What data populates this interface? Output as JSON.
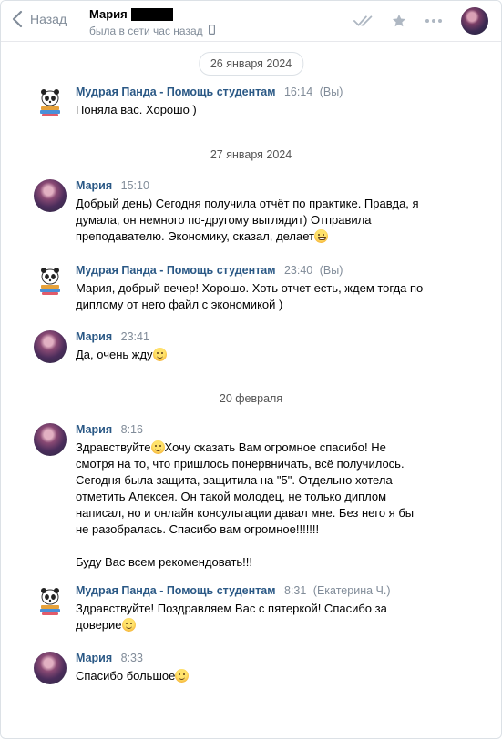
{
  "header": {
    "back_label": "Назад",
    "contact_name": "Мария",
    "status": "была в сети час назад",
    "icons": [
      "chevron-left-icon",
      "phone-icon",
      "double-check-icon",
      "star-icon",
      "more-icon"
    ]
  },
  "colors": {
    "author": "#2a5885",
    "muted": "#818c99",
    "border": "#dce1e6"
  },
  "dates": {
    "d1": "26 января 2024",
    "d2": "27 января 2024",
    "d3": "20 февраля"
  },
  "messages": [
    {
      "author": "Мудрая Панда - Помощь студентам",
      "time": "16:14",
      "note": "(Вы)",
      "text": "Поняла вас. Хорошо )"
    },
    {
      "author": "Мария",
      "time": "15:10",
      "line1": "Добрый день) Сегодня получила отчёт по практике. Правда, я",
      "line2": "думала, он немного по-другому выглядит) Отправила",
      "line3": "преподавателю. Экономику, сказал, делает"
    },
    {
      "author": "Мудрая Панда - Помощь студентам",
      "time": "23:40",
      "note": "(Вы)",
      "line1": "Мария, добрый вечер! Хорошо. Хоть отчет есть, ждем тогда по",
      "line2": "диплому от него файл с экономикой )"
    },
    {
      "author": "Мария",
      "time": "23:41",
      "text": "Да, очень жду"
    },
    {
      "author": "Мария",
      "time": "8:16",
      "line1a": "Здравствуйте",
      "line1b": "Хочу сказать Вам огромное спасибо! Не",
      "line2": "смотря на то, что пришлось понервничать, всё получилось.",
      "line3": "Сегодня была защита, защитила на \"5\". Отдельно хотела",
      "line4": "отметить Алексея. Он такой молодец, не только диплом",
      "line5": "написал, но и онлайн консультации давал мне. Без него я бы",
      "line6": "не разобралась. Спасибо вам огромное!!!!!!!",
      "para2": "Буду Вас всем рекомендовать!!!"
    },
    {
      "author": "Мудрая Панда - Помощь студентам",
      "time": "8:31",
      "note": "(Екатерина Ч.)",
      "line1": "Здравствуйте! Поздравляем Вас с пятеркой! Спасибо за",
      "line2": "доверие"
    },
    {
      "author": "Мария",
      "time": "8:33",
      "text": "Спасибо большое"
    }
  ]
}
